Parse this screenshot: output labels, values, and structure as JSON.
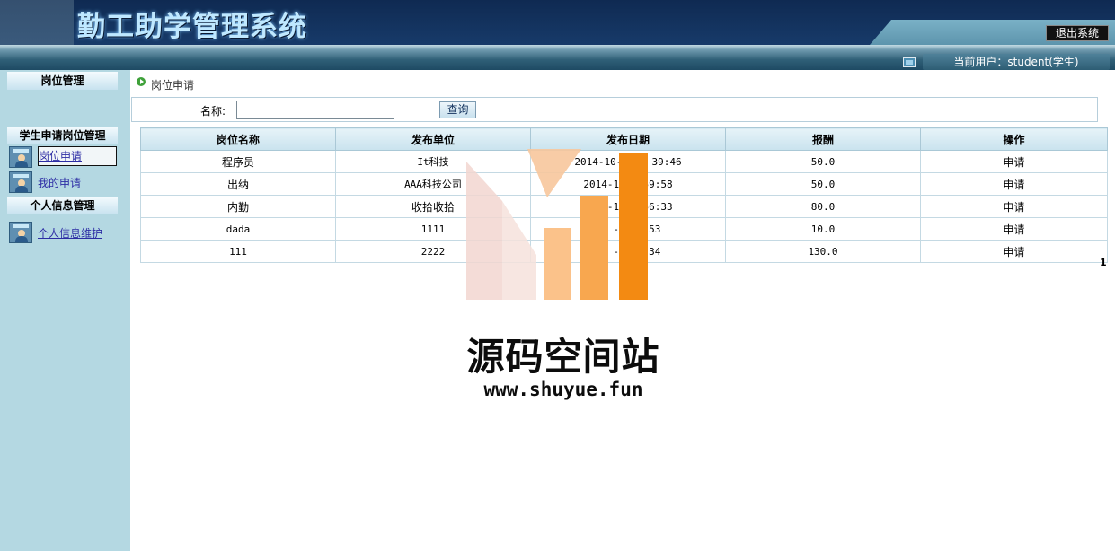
{
  "app": {
    "title": "勤工助学管理系统",
    "logout_label": "退出系统",
    "current_user": "当前用户：student(学生)"
  },
  "sidebar": {
    "sections": [
      {
        "title": "岗位管理",
        "items": []
      },
      {
        "title": "学生申请岗位管理",
        "items": [
          {
            "label": "岗位申请",
            "active": true
          },
          {
            "label": "我的申请",
            "active": false
          }
        ]
      },
      {
        "title": "个人信息管理",
        "items": [
          {
            "label": "个人信息维护",
            "active": false
          }
        ]
      }
    ]
  },
  "main": {
    "breadcrumb": "岗位申请",
    "search": {
      "label": "名称:",
      "value": "",
      "button_label": "查询"
    },
    "table": {
      "headers": [
        "岗位名称",
        "发布单位",
        "发布日期",
        "报酬",
        "操作"
      ],
      "rows": [
        {
          "name": "程序员",
          "unit": "It科技",
          "date": "2014-10-23 1  39:46",
          "pay": "50.0",
          "action": "申请"
        },
        {
          "name": "出纳",
          "unit": "AAA科技公司",
          "date": "2014-10-1   59:58",
          "pay": "50.0",
          "action": "申请"
        },
        {
          "name": "内勤",
          "unit": "收拾收拾",
          "date": "2014-1  -1   56:33",
          "pay": "80.0",
          "action": "申请"
        },
        {
          "name": "dada",
          "unit": "1111",
          "date": "20   -2   32:53",
          "pay": "10.0",
          "action": "申请"
        },
        {
          "name": "111",
          "unit": "2222",
          "date": "20   -2   11:34",
          "pay": "130.0",
          "action": "申请"
        }
      ]
    },
    "pager": "1"
  },
  "watermark": {
    "title": "源码空间站",
    "url": "www.shuyue.fun"
  },
  "colors": {
    "header_dark": "#163866",
    "sidebar_bg": "#b4d8e2",
    "table_border": "#aac8d6",
    "watermark_orange": "#f39a3a"
  }
}
